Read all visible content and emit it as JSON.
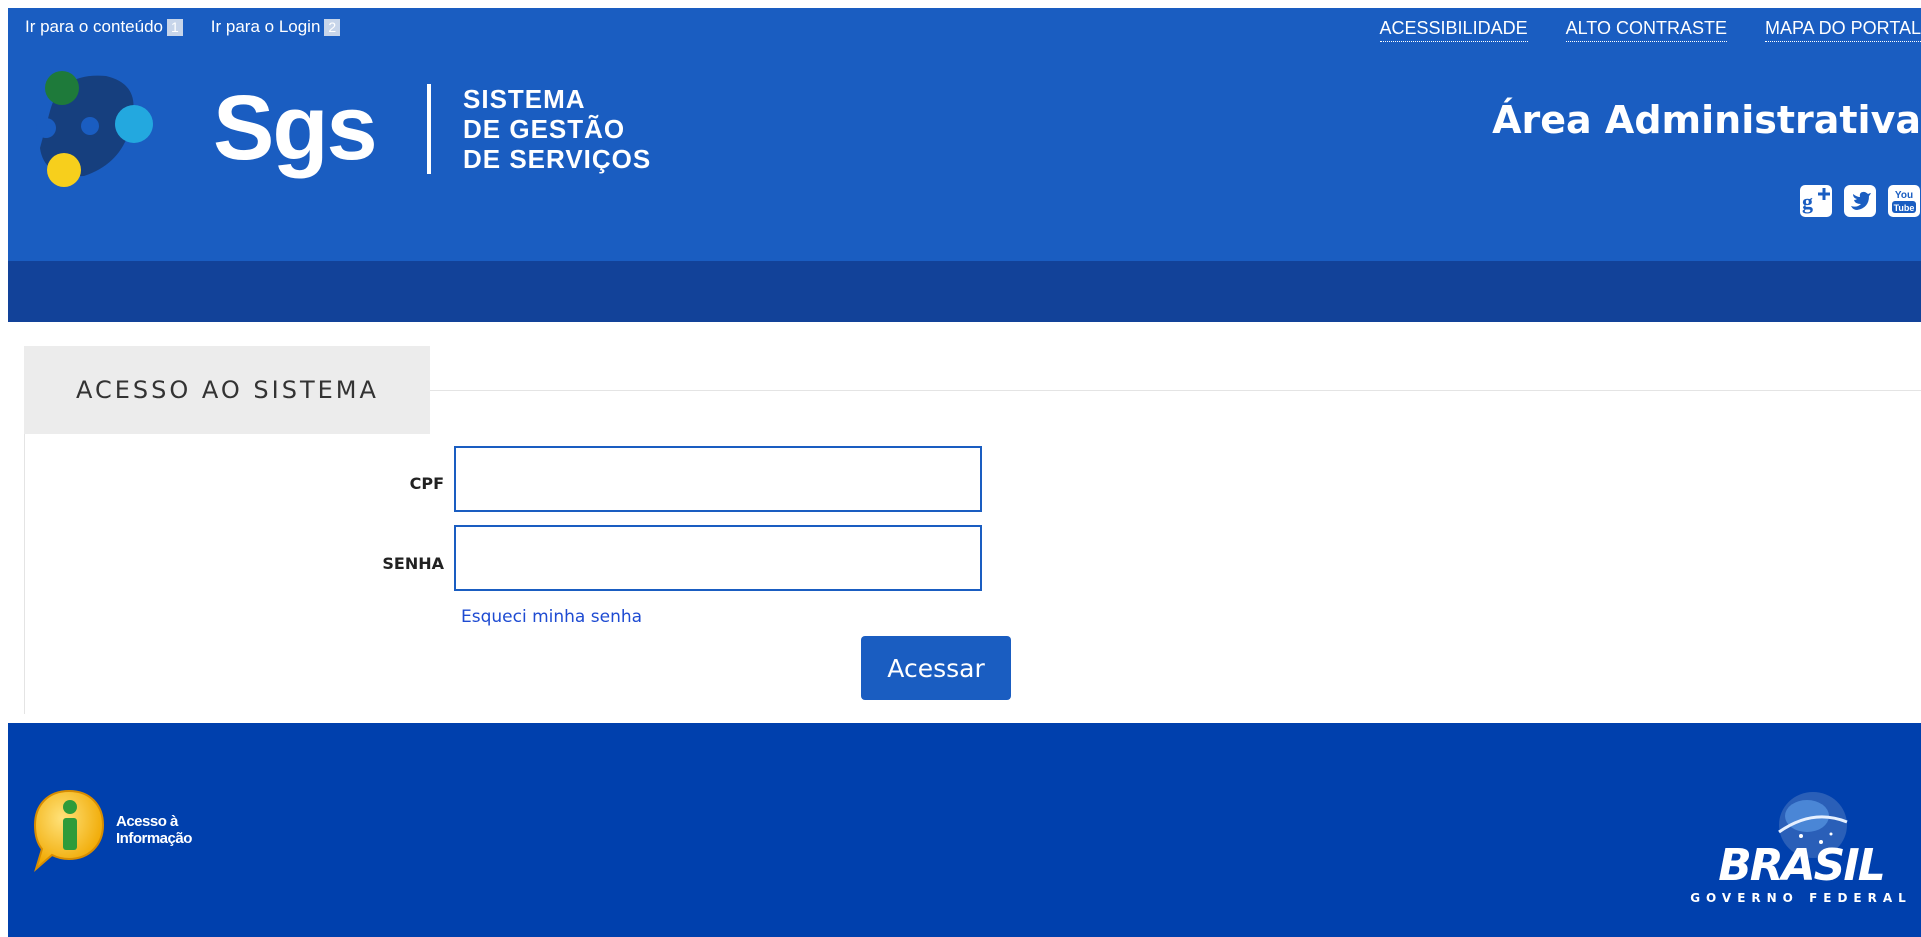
{
  "skip_links": [
    {
      "label": "Ir para o conteúdo",
      "key": "1"
    },
    {
      "label": "Ir para o Login",
      "key": "2"
    }
  ],
  "top_links": [
    "ACESSIBILIDADE",
    "ALTO CONTRASTE",
    "MAPA DO PORTAL"
  ],
  "logo": {
    "name": "Sgs",
    "subtitle_lines": [
      "SISTEMA",
      "DE GESTÃO",
      "DE SERVIÇOS"
    ]
  },
  "area_title": "Área Administrativa",
  "social_icons": [
    "google-plus-icon",
    "twitter-icon",
    "youtube-icon"
  ],
  "login": {
    "section_title": "ACESSO AO SISTEMA",
    "cpf_label": "CPF",
    "cpf_value": "",
    "password_label": "SENHA",
    "password_value": "",
    "forgot_password": "Esqueci minha senha",
    "submit_label": "Acessar"
  },
  "footer": {
    "acesso_info_lines": [
      "Acesso à",
      "Informação"
    ],
    "brasil_word": "BRASIL",
    "governo_word": "GOVERNO FEDERAL"
  },
  "colors": {
    "header_blue": "#1a5dc1",
    "header_band": "#124299",
    "footer_blue": "#0040ad",
    "link_blue": "#1e4bd2"
  }
}
